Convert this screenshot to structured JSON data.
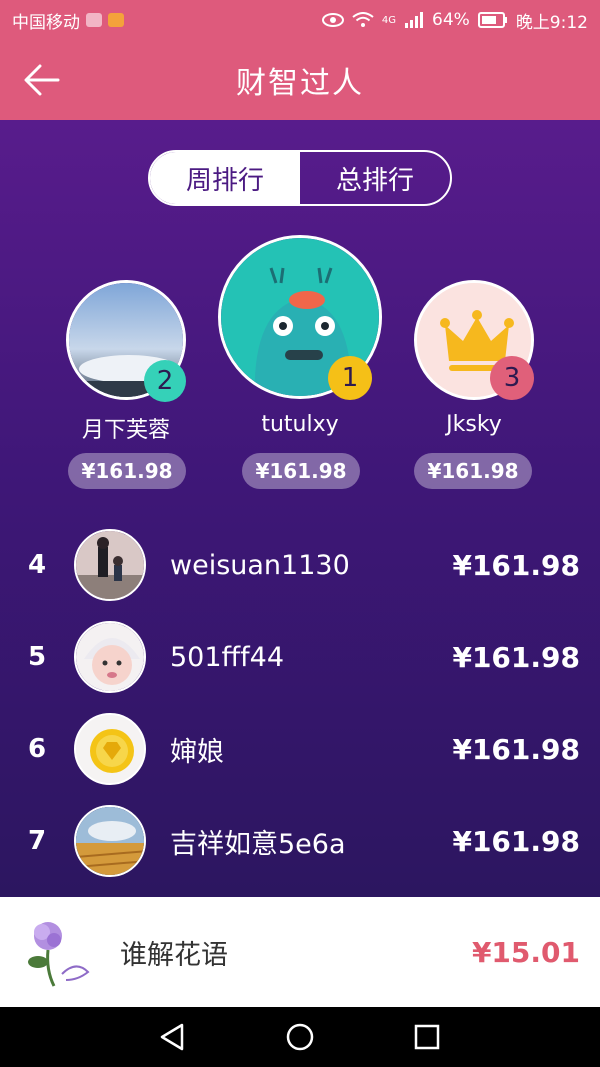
{
  "statusbar": {
    "carrier": "中国移动",
    "network": "4G",
    "battery": "64%",
    "time": "晚上9:12"
  },
  "appbar": {
    "title": "财智过人",
    "back_icon": "arrow-left-icon"
  },
  "tabs": [
    {
      "label": "周排行",
      "active": true
    },
    {
      "label": "总排行",
      "active": false
    }
  ],
  "podium": [
    {
      "rank": "1",
      "name": "tutulxy",
      "amount": "¥161.98",
      "badge_color": "#f5c017"
    },
    {
      "rank": "2",
      "name": "月下芙蓉",
      "amount": "¥161.98",
      "badge_color": "#35d1b8"
    },
    {
      "rank": "3",
      "name": "Jksky",
      "amount": "¥161.98",
      "badge_color": "#e0607a"
    }
  ],
  "list": [
    {
      "rank": "4",
      "name": "weisuan1130",
      "amount": "¥161.98"
    },
    {
      "rank": "5",
      "name": "501fff44",
      "amount": "¥161.98"
    },
    {
      "rank": "6",
      "name": "婶娘",
      "amount": "¥161.98"
    },
    {
      "rank": "7",
      "name": "吉祥如意5e6a",
      "amount": "¥161.98"
    }
  ],
  "me": {
    "name": "谁解花语",
    "amount": "¥15.01"
  },
  "colors": {
    "accent": "#de5a7c",
    "bg_top": "#581c8c",
    "bg_bottom": "#2c1660",
    "my_amount": "#e05a6e"
  }
}
